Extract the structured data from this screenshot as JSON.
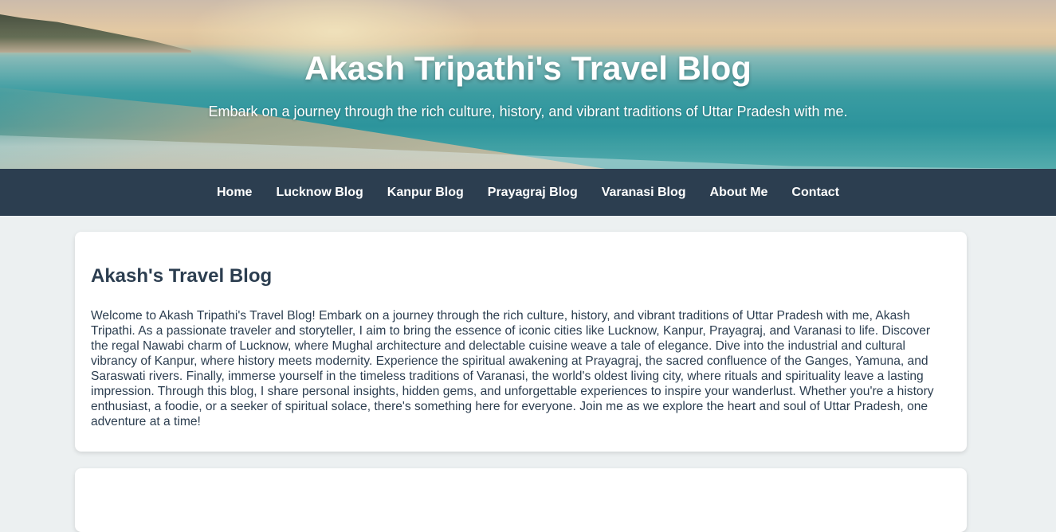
{
  "header": {
    "title": "Akash Tripathi's Travel Blog",
    "subtitle": "Embark on a journey through the rich culture, history, and vibrant traditions of Uttar Pradesh with me."
  },
  "nav": {
    "items": [
      {
        "label": "Home"
      },
      {
        "label": "Lucknow Blog"
      },
      {
        "label": "Kanpur Blog"
      },
      {
        "label": "Prayagraj Blog"
      },
      {
        "label": "Varanasi Blog"
      },
      {
        "label": "About Me"
      },
      {
        "label": "Contact"
      }
    ]
  },
  "intro": {
    "heading": "Akash's Travel Blog",
    "body": "Welcome to Akash Tripathi's Travel Blog! Embark on a journey through the rich culture, history, and vibrant traditions of Uttar Pradesh with me, Akash Tripathi. As a passionate traveler and storyteller, I aim to bring the essence of iconic cities like Lucknow, Kanpur, Prayagraj, and Varanasi to life. Discover the regal Nawabi charm of Lucknow, where Mughal architecture and delectable cuisine weave a tale of elegance. Dive into the industrial and cultural vibrancy of Kanpur, where history meets modernity. Experience the spiritual awakening at Prayagraj, the sacred confluence of the Ganges, Yamuna, and Saraswati rivers. Finally, immerse yourself in the timeless traditions of Varanasi, the world's oldest living city, where rituals and spirituality leave a lasting impression. Through this blog, I share personal insights, hidden gems, and unforgettable experiences to inspire your wanderlust. Whether you're a history enthusiast, a foodie, or a seeker of spiritual solace, there's something here for everyone. Join me as we explore the heart and soul of Uttar Pradesh, one adventure at a time!"
  },
  "colors": {
    "nav_bg": "#2c3e50",
    "page_bg": "#ecf0f1",
    "text": "#2c3e50",
    "card_bg": "#ffffff"
  }
}
